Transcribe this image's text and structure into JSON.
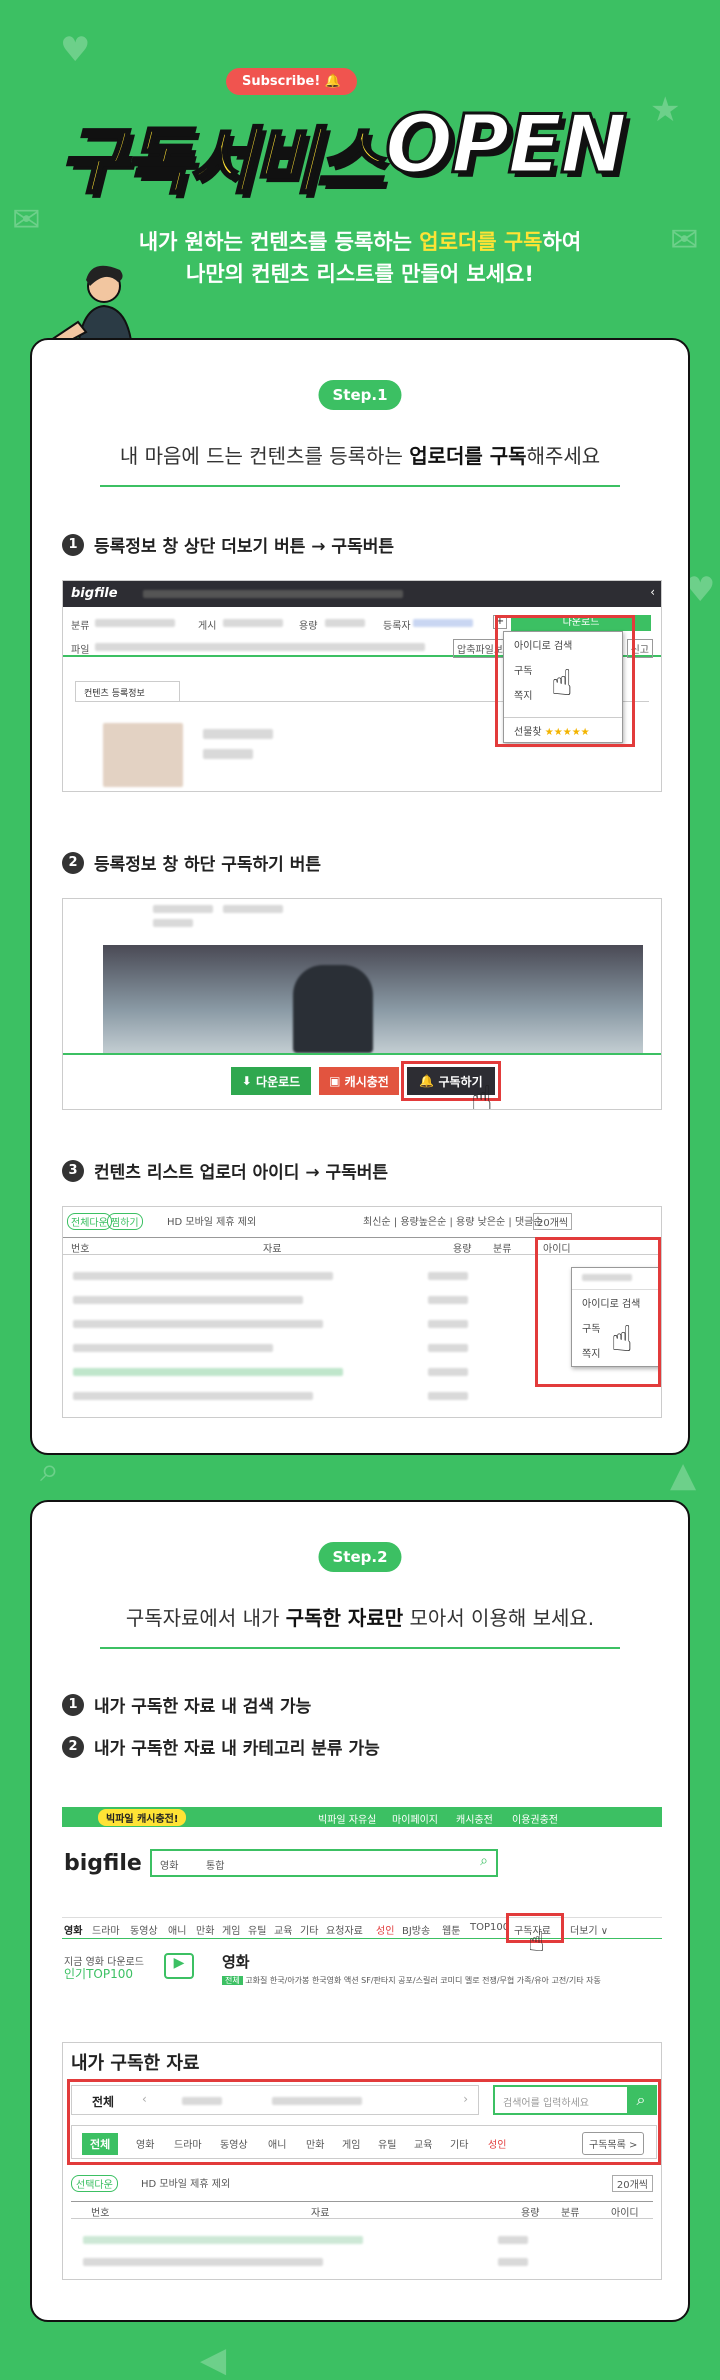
{
  "hero": {
    "subscribe_pill": "Subscribe! 🔔",
    "title_kr": "구독서비스",
    "title_en": "OPEN",
    "line1_pre": "내가 원하는 컨텐츠를 등록하는 ",
    "line1_hl": "업로더를 구독",
    "line1_post": "하여",
    "line2": "나만의 컨텐츠 리스트를 만들어 보세요!"
  },
  "step1": {
    "badge": "Step.1",
    "head_pre": "내 마음에 드는 컨텐츠를 등록하는 ",
    "head_bold": "업로더를 구독",
    "head_post": "해주세요",
    "items": [
      {
        "num": "1",
        "text": "등록정보 창 상단 더보기 버튼 → 구독버튼"
      },
      {
        "num": "2",
        "text": "등록정보 창 하단 구독하기 버튼"
      },
      {
        "num": "3",
        "text": "컨텐츠 리스트 업로더 아이디 → 구독버튼"
      }
    ],
    "shot1": {
      "logo": "bigfile",
      "download": "다운로드",
      "labels": [
        "분류",
        "게시",
        "용량",
        "등록자"
      ],
      "file_label": "파일",
      "tab": "컨텐츠 등록정보",
      "menu": [
        "아이디로 검색",
        "구독",
        "쪽지"
      ],
      "rating_label": "선물찾",
      "stars": "★★★★★",
      "report": "신고",
      "zip_label": "압축파일보기"
    },
    "shot2": {
      "buttons": [
        "다운로드",
        "캐시충전",
        "구독하기"
      ]
    },
    "shot3": {
      "tags": [
        "전체다운",
        "찜하기"
      ],
      "opts": "HD  모바일  제휴 제외",
      "sort": "최신순 | 용량높은순 | 용량 낮은순 | 댓글순",
      "count": "20개씩",
      "cols": [
        "번호",
        "자료",
        "용량",
        "분류",
        "아이디"
      ],
      "menu": [
        "아이디로 검색",
        "구독",
        "쪽지"
      ]
    }
  },
  "step2": {
    "badge": "Step.2",
    "head_pre": "구독자료에서 내가 ",
    "head_bold": "구독한 자료만",
    "head_post": " 모아서 이용해 보세요.",
    "items": [
      {
        "num": "1",
        "text": "내가 구독한 자료 내 검색 가능"
      },
      {
        "num": "2",
        "text": "내가 구독한 자료 내 카테고리 분류 가능"
      }
    ],
    "shot4": {
      "promo": "빅파일 캐시충전!",
      "top_links": [
        "빅파일 자유실",
        "마이페이지",
        "캐시충전",
        "이용권충전"
      ],
      "logo": "bigfile",
      "search_sel1": "영화",
      "search_sel2": "통합",
      "nav": [
        "영화",
        "드라마",
        "동영상",
        "애니",
        "만화",
        "게임",
        "유틸",
        "교육",
        "기타",
        "요청자료",
        "성인",
        "BJ방송",
        "웹툰",
        "TOP100",
        "구독자료",
        "더보기 ∨"
      ],
      "rank_title": "지금 영화 다운로드",
      "rank_sub": "인기TOP100",
      "section": "영화",
      "genre_all": "전체",
      "genres": "고화질 한국/아가봉 한국영화 액션 SF/판타지 공포/스릴러 코미디 멜로 전쟁/무협 가족/유아 고전/기타 자동"
    },
    "shot5": {
      "title": "내가 구독한 자료",
      "scope": "전체",
      "search_placeholder": "검색어를 입력하세요",
      "cats": [
        "전체",
        "영화",
        "드라마",
        "동영상",
        "애니",
        "만화",
        "게임",
        "유틸",
        "교육",
        "기타",
        "성인"
      ],
      "list_btn": "구독목록 >",
      "tag": "선택다운",
      "opts": "HD  모바일  제휴 제외",
      "count": "20개씩",
      "cols": [
        "번호",
        "자료",
        "용량",
        "분류",
        "아이디"
      ]
    }
  },
  "colors": {
    "green": "#3cc063",
    "yellow": "#ffe335",
    "red": "#e23b3b",
    "dark": "#2d2d33"
  }
}
